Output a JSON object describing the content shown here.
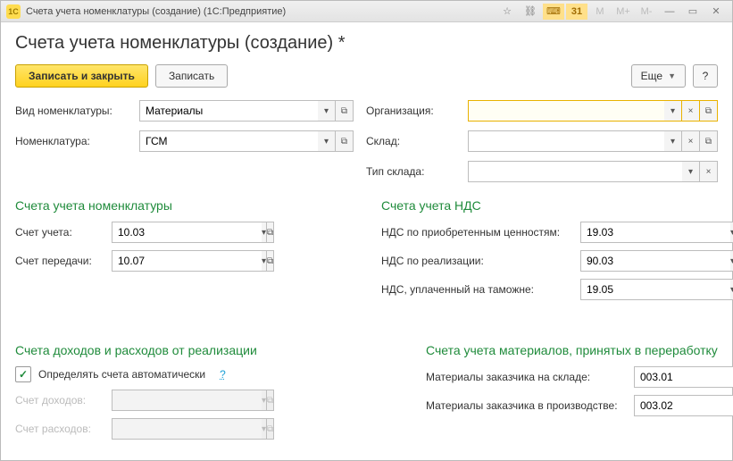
{
  "window": {
    "title": "Счета учета номенклатуры (создание)  (1С:Предприятие)",
    "app_icon_text": "1C"
  },
  "page_title": "Счета учета номенклатуры (создание) *",
  "toolbar": {
    "save_close": "Записать и закрыть",
    "save": "Записать",
    "more": "Еще",
    "help": "?"
  },
  "fields": {
    "nomenclature_type_label": "Вид номенклатуры:",
    "nomenclature_type_value": "Материалы",
    "nomenclature_label": "Номенклатура:",
    "nomenclature_value": "ГСМ",
    "organization_label": "Организация:",
    "organization_value": "",
    "warehouse_label": "Склад:",
    "warehouse_value": "",
    "warehouse_type_label": "Тип склада:",
    "warehouse_type_value": ""
  },
  "sections": {
    "accounts_title": "Счета учета номенклатуры",
    "vat_title": "Счета учета НДС",
    "income_expense_title": "Счета доходов и расходов от реализации",
    "materials_title": "Счета учета материалов, принятых в переработку"
  },
  "accounts": {
    "account_label": "Счет учета:",
    "account_value": "10.03",
    "transfer_label": "Счет передачи:",
    "transfer_value": "10.07"
  },
  "vat": {
    "purchased_label": "НДС по приобретенным ценностям:",
    "purchased_value": "19.03",
    "sales_label": "НДС по реализации:",
    "sales_value": "90.03",
    "customs_label": "НДС, уплаченный на таможне:",
    "customs_value": "19.05"
  },
  "income_expense": {
    "auto_detect_label": "Определять счета автоматически",
    "auto_detect_checked": true,
    "income_label": "Счет доходов:",
    "income_value": "",
    "expense_label": "Счет расходов:",
    "expense_value": ""
  },
  "materials": {
    "customer_warehouse_label": "Материалы заказчика на складе:",
    "customer_warehouse_value": "003.01",
    "customer_production_label": "Материалы заказчика в производстве:",
    "customer_production_value": "003.02"
  },
  "glyph": {
    "dropdown": "▾",
    "open": "☐",
    "clear": "×",
    "expand": "⧉"
  }
}
